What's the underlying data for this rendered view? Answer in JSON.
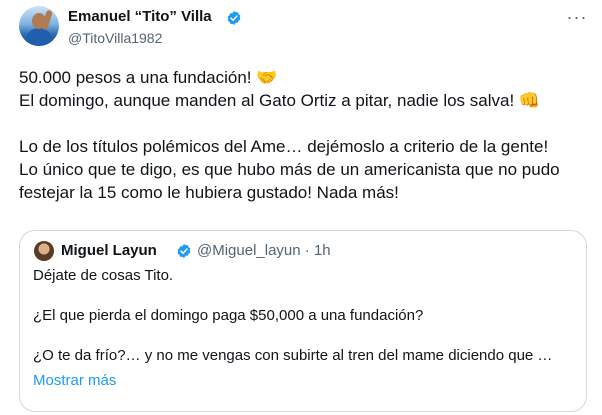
{
  "author": {
    "name": "Emanuel “Tito” Villa",
    "handle": "@TitoVilla1982"
  },
  "tweet": {
    "lines": [
      "50.000 pesos a una fundación! 🤝",
      "El domingo, aunque manden al Gato Ortiz a pitar, nadie los salva! 👊",
      "",
      "Lo de los títulos polémicos del Ame… dejémoslo a criterio de la gente!",
      "Lo único que te digo, es que hubo más de un americanista que no pudo",
      "festejar la 15 como le hubiera gustado! Nada más!"
    ]
  },
  "quoted": {
    "name": "Miguel Layun",
    "handle": "@Miguel_layun",
    "separator": "·",
    "time": "1h",
    "lines": [
      "Déjate de cosas Tito.",
      "",
      "¿El que pierda el domingo paga $50,000 a una fundación?",
      "",
      "¿O te da frío?… y no me vengas con subirte al tren del mame diciendo que …"
    ],
    "show_more": "Mostrar más"
  },
  "icons": {
    "verified": "verified-badge-icon",
    "more": "more-options-icon"
  },
  "colors": {
    "accent": "#1d9bf0",
    "text": "#0f1419",
    "secondary": "#536471",
    "border": "#cfd9de"
  }
}
